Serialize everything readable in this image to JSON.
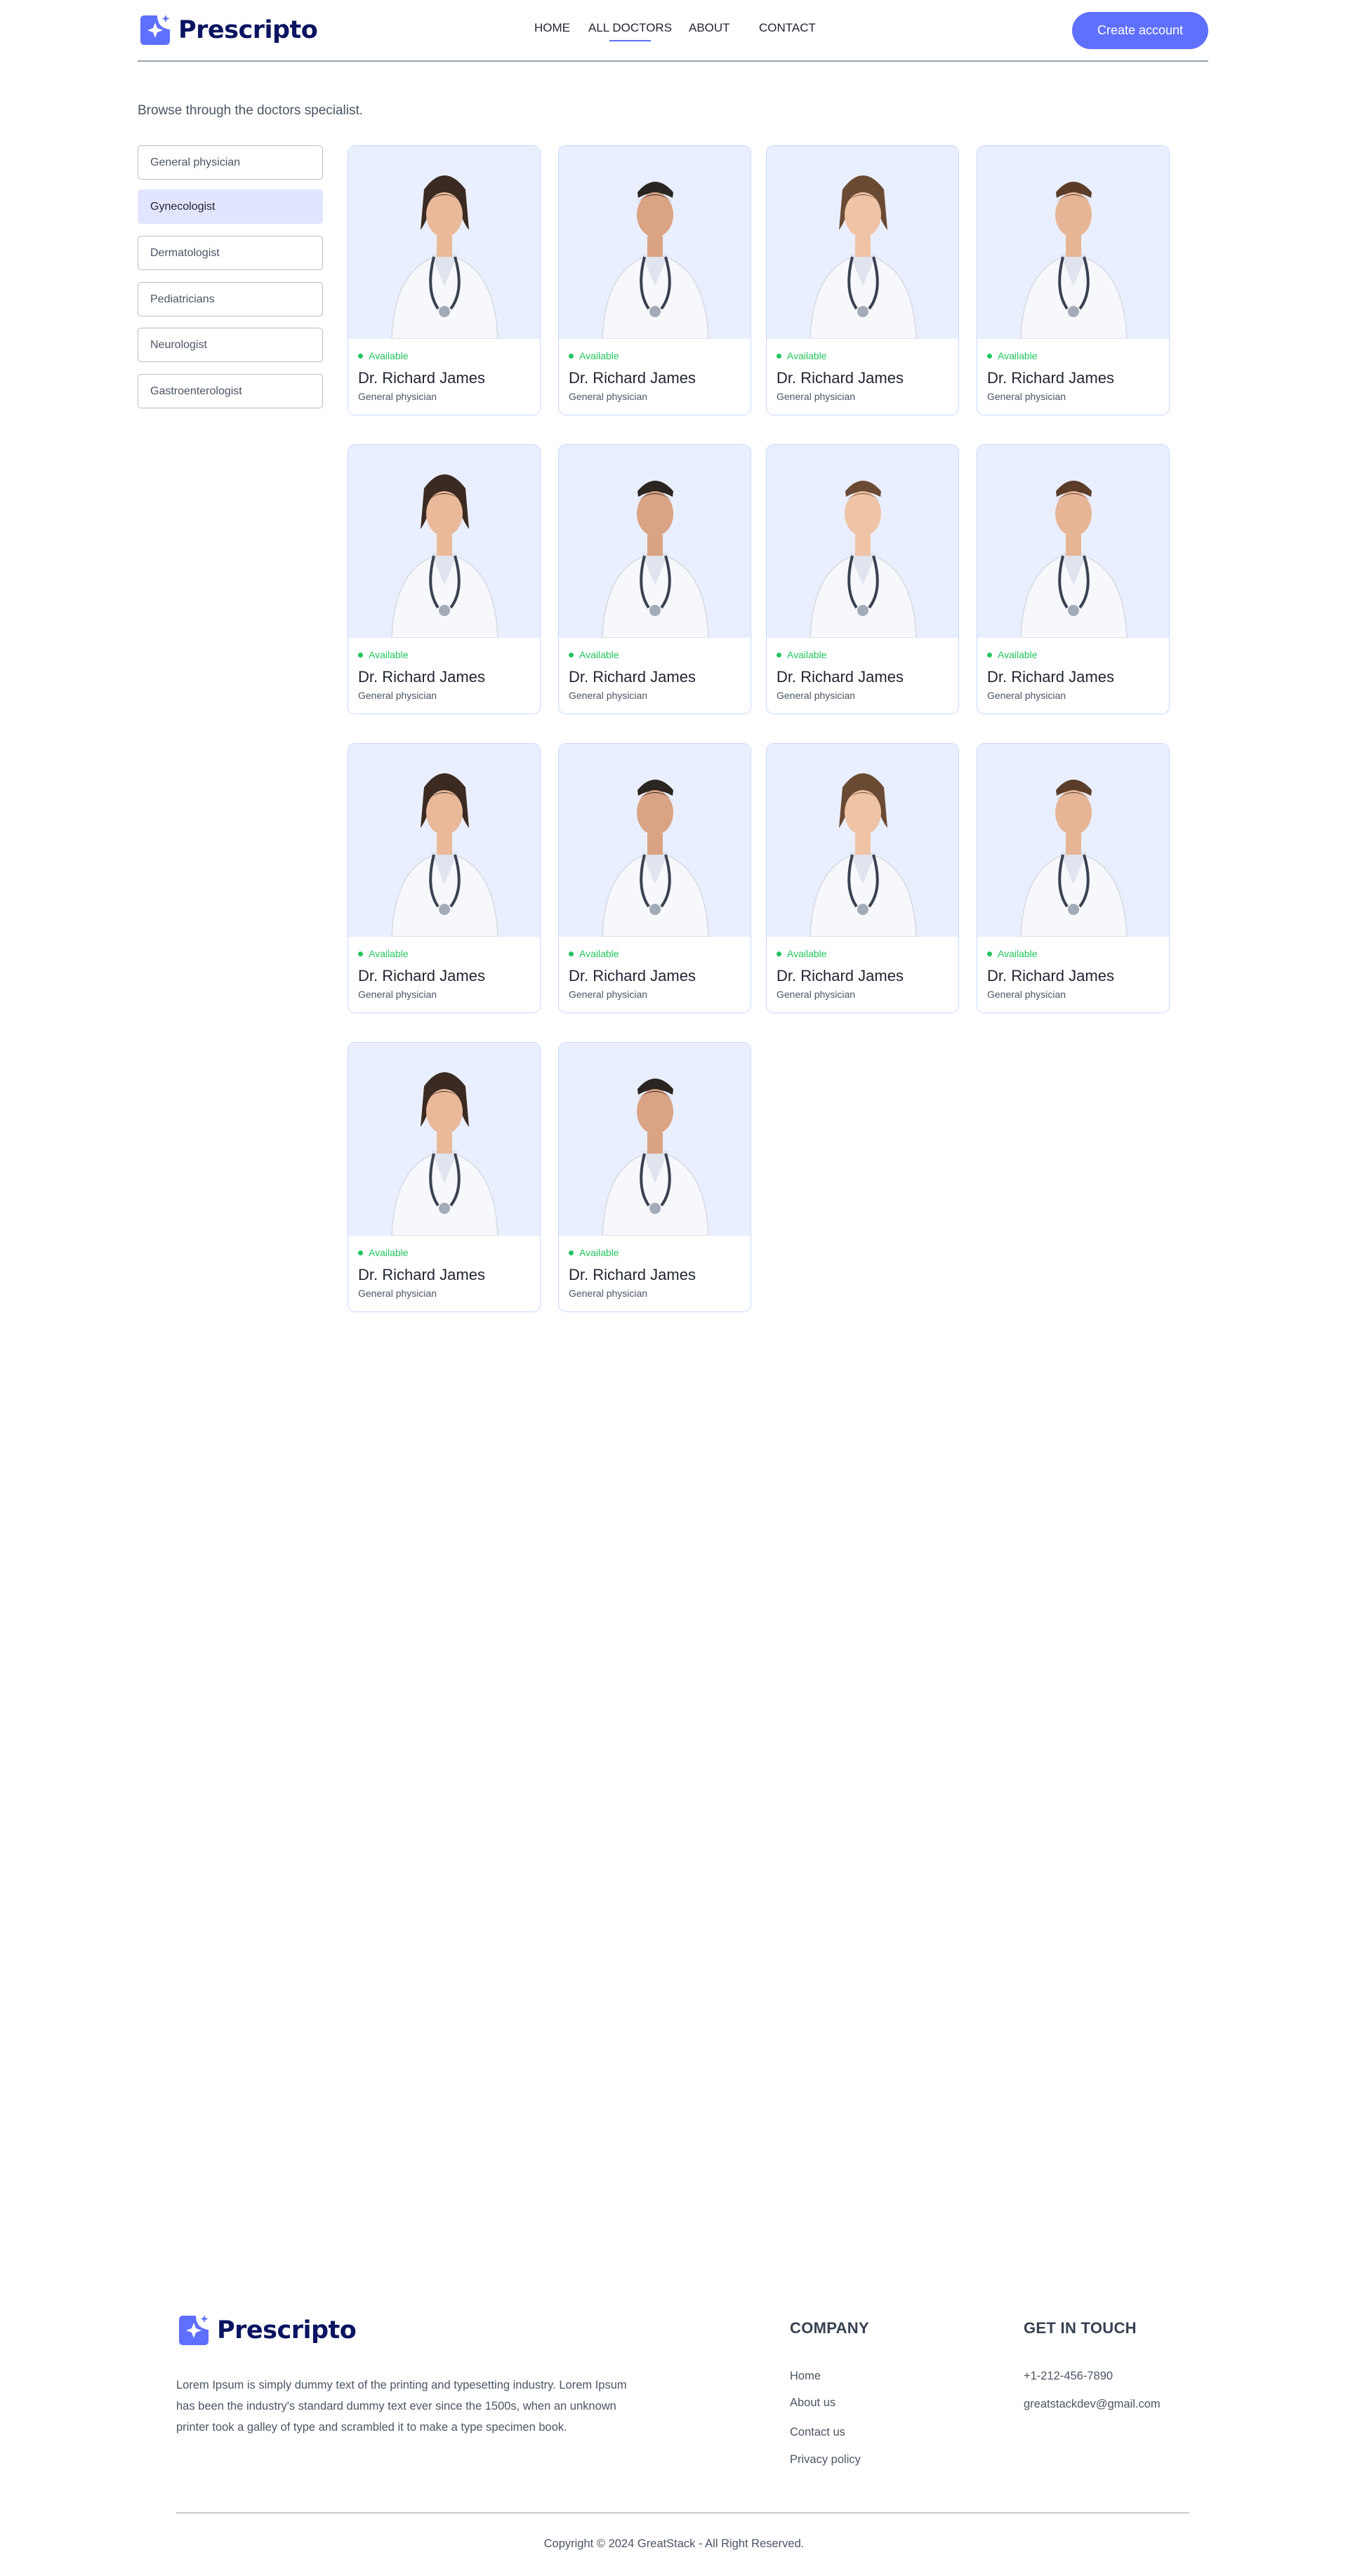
{
  "app": {
    "brand": "Prescripto"
  },
  "nav": {
    "links": [
      {
        "label": "HOME"
      },
      {
        "label": "ALL DOCTORS"
      },
      {
        "label": "ABOUT"
      },
      {
        "label": "CONTACT"
      }
    ],
    "active": "ALL DOCTORS",
    "cta_label": "Create account"
  },
  "browse_text": "Browse through the doctors specialist.",
  "filters": [
    {
      "label": "General physician"
    },
    {
      "label": "Gynecologist",
      "active": true
    },
    {
      "label": "Dermatologist"
    },
    {
      "label": "Pediatricians"
    },
    {
      "label": "Neurologist"
    },
    {
      "label": "Gastroenterologist"
    }
  ],
  "doctors": [
    {
      "status": "Available",
      "name": "Dr. Richard James",
      "speciality": "General physician",
      "gender": "female"
    },
    {
      "status": "Available",
      "name": "Dr. Richard James",
      "speciality": "General physician",
      "gender": "male"
    },
    {
      "status": "Available",
      "name": "Dr. Richard James",
      "speciality": "General physician",
      "gender": "female"
    },
    {
      "status": "Available",
      "name": "Dr. Richard James",
      "speciality": "General physician",
      "gender": "male"
    },
    {
      "status": "Available",
      "name": "Dr. Richard James",
      "speciality": "General physician",
      "gender": "female"
    },
    {
      "status": "Available",
      "name": "Dr. Richard James",
      "speciality": "General physician",
      "gender": "male"
    },
    {
      "status": "Available",
      "name": "Dr. Richard James",
      "speciality": "General physician",
      "gender": "male"
    },
    {
      "status": "Available",
      "name": "Dr. Richard James",
      "speciality": "General physician",
      "gender": "male"
    },
    {
      "status": "Available",
      "name": "Dr. Richard James",
      "speciality": "General physician",
      "gender": "female"
    },
    {
      "status": "Available",
      "name": "Dr. Richard James",
      "speciality": "General physician",
      "gender": "male"
    },
    {
      "status": "Available",
      "name": "Dr. Richard James",
      "speciality": "General physician",
      "gender": "female"
    },
    {
      "status": "Available",
      "name": "Dr. Richard James",
      "speciality": "General physician",
      "gender": "male"
    },
    {
      "status": "Available",
      "name": "Dr. Richard James",
      "speciality": "General physician",
      "gender": "female"
    },
    {
      "status": "Available",
      "name": "Dr. Richard James",
      "speciality": "General physician",
      "gender": "male"
    }
  ],
  "footer": {
    "brand": "Prescripto",
    "description": "Lorem Ipsum is simply dummy text of the printing and typesetting industry. Lorem Ipsum has been the industry's standard dummy text ever since the 1500s, when an unknown printer took a galley of type and scrambled it to make a type specimen book.",
    "company_heading": "COMPANY",
    "company_links": [
      "Home",
      "About us",
      "Contact us",
      "Privacy policy"
    ],
    "contact_heading": "GET IN TOUCH",
    "phone": "+1-212-456-7890",
    "email": "greatstackdev@gmail.com",
    "copyright": "Copyright © 2024 GreatStack - All Right Reserved."
  },
  "colors": {
    "primary": "#5f6fff",
    "brand_text": "#0b1460",
    "card_bg": "#eaefff",
    "available": "#22c55e",
    "filter_active": "#e2e5ff"
  }
}
